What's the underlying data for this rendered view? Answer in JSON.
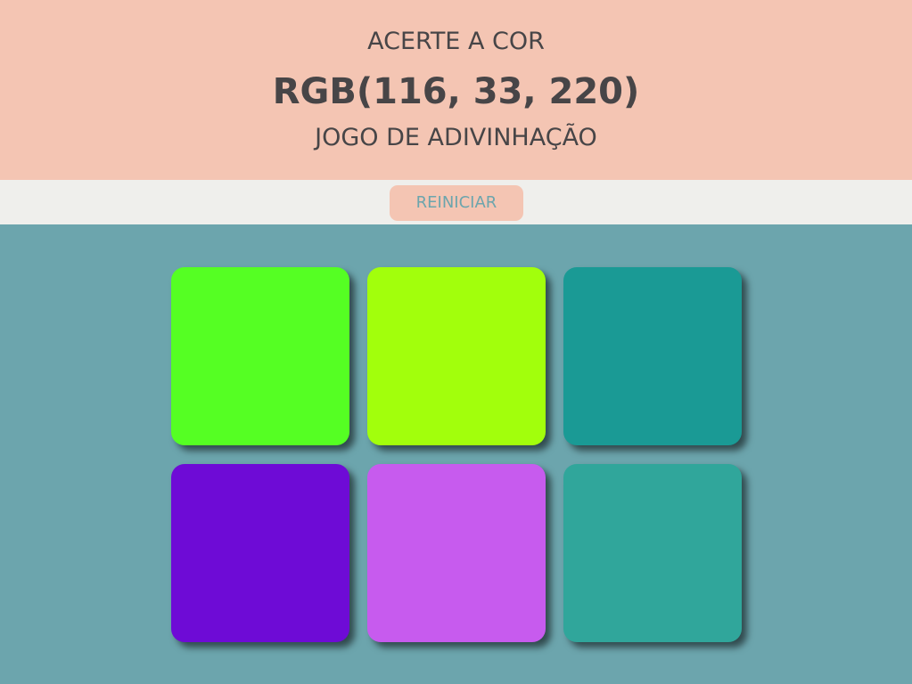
{
  "header": {
    "subtitle_top": "ACERTE A COR",
    "rgb_target": "RGB(116, 33, 220)",
    "subtitle_bottom": "JOGO DE ADIVINHAÇÃO",
    "background": "#f4c5b3",
    "text_color": "#474547"
  },
  "toolbar": {
    "reset_label": "REINICIAR",
    "background": "#efefec"
  },
  "board": {
    "background": "#6ca5ad",
    "squares": [
      {
        "color": "#55ff23"
      },
      {
        "color": "#a2ff0c"
      },
      {
        "color": "#1a9a95"
      },
      {
        "color": "#6e0bd6"
      },
      {
        "color": "#c75bee"
      },
      {
        "color": "#30a69b"
      }
    ]
  }
}
